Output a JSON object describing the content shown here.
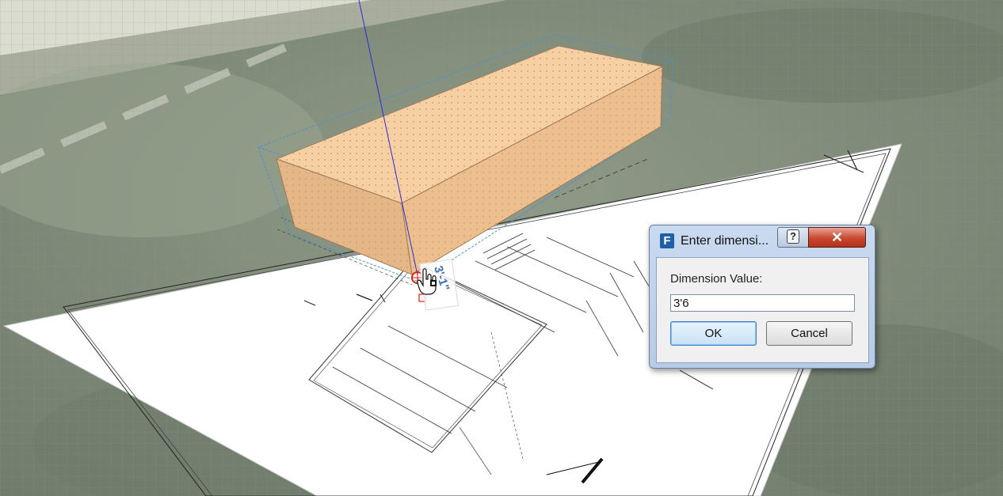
{
  "dialog": {
    "title": "Enter dimensi...",
    "app_icon_letter": "F",
    "help_glyph": "?",
    "close_glyph": "✕",
    "field_label": "Dimension Value:",
    "field_value": "3'6",
    "ok_label": "OK",
    "cancel_label": "Cancel"
  },
  "viewport": {
    "dimension_readout": "3'-1\""
  },
  "colors": {
    "block_top": "#f6cfa3",
    "block_side": "#e9b987",
    "dialog_frame": "#b9cde7",
    "close_button": "#c7472f"
  }
}
